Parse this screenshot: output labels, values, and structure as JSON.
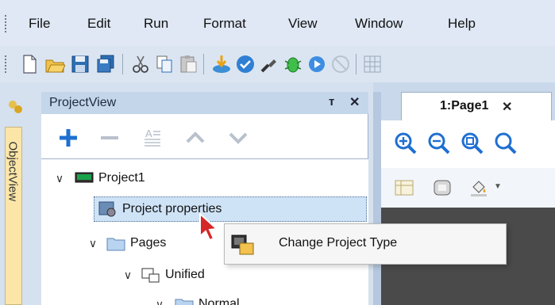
{
  "menu": {
    "items": [
      "File",
      "Edit",
      "Run",
      "Format",
      "View",
      "Window",
      "Help"
    ]
  },
  "toolbar": {
    "icons": [
      "new-file-icon",
      "open-folder-icon",
      "save-icon",
      "save-all-icon",
      "cut-icon",
      "copy-icon",
      "paste-icon",
      "download-icon",
      "validate-icon",
      "usb-key-icon",
      "debug-icon",
      "run-icon",
      "stop-icon",
      "grid-icon"
    ]
  },
  "left_tab": {
    "label": "ObjectView"
  },
  "project_view": {
    "title": "ProjectView",
    "pin_glyph": "ᴛ",
    "close_glyph": "✕",
    "tools": [
      "add-icon",
      "remove-icon",
      "rename-icon",
      "move-up-icon",
      "move-down-icon"
    ]
  },
  "tree": {
    "project": "Project1",
    "properties": "Project properties",
    "pages": "Pages",
    "unified": "Unified",
    "normal": "Normal"
  },
  "document": {
    "tab_label": "1:Page1",
    "tab_close": "✕"
  },
  "context_menu": {
    "item": "Change Project Type"
  },
  "colors": {
    "accent_blue": "#1f6fd1",
    "selection": "#cfe3f7",
    "tree_select_border": "#7aa7d6"
  }
}
